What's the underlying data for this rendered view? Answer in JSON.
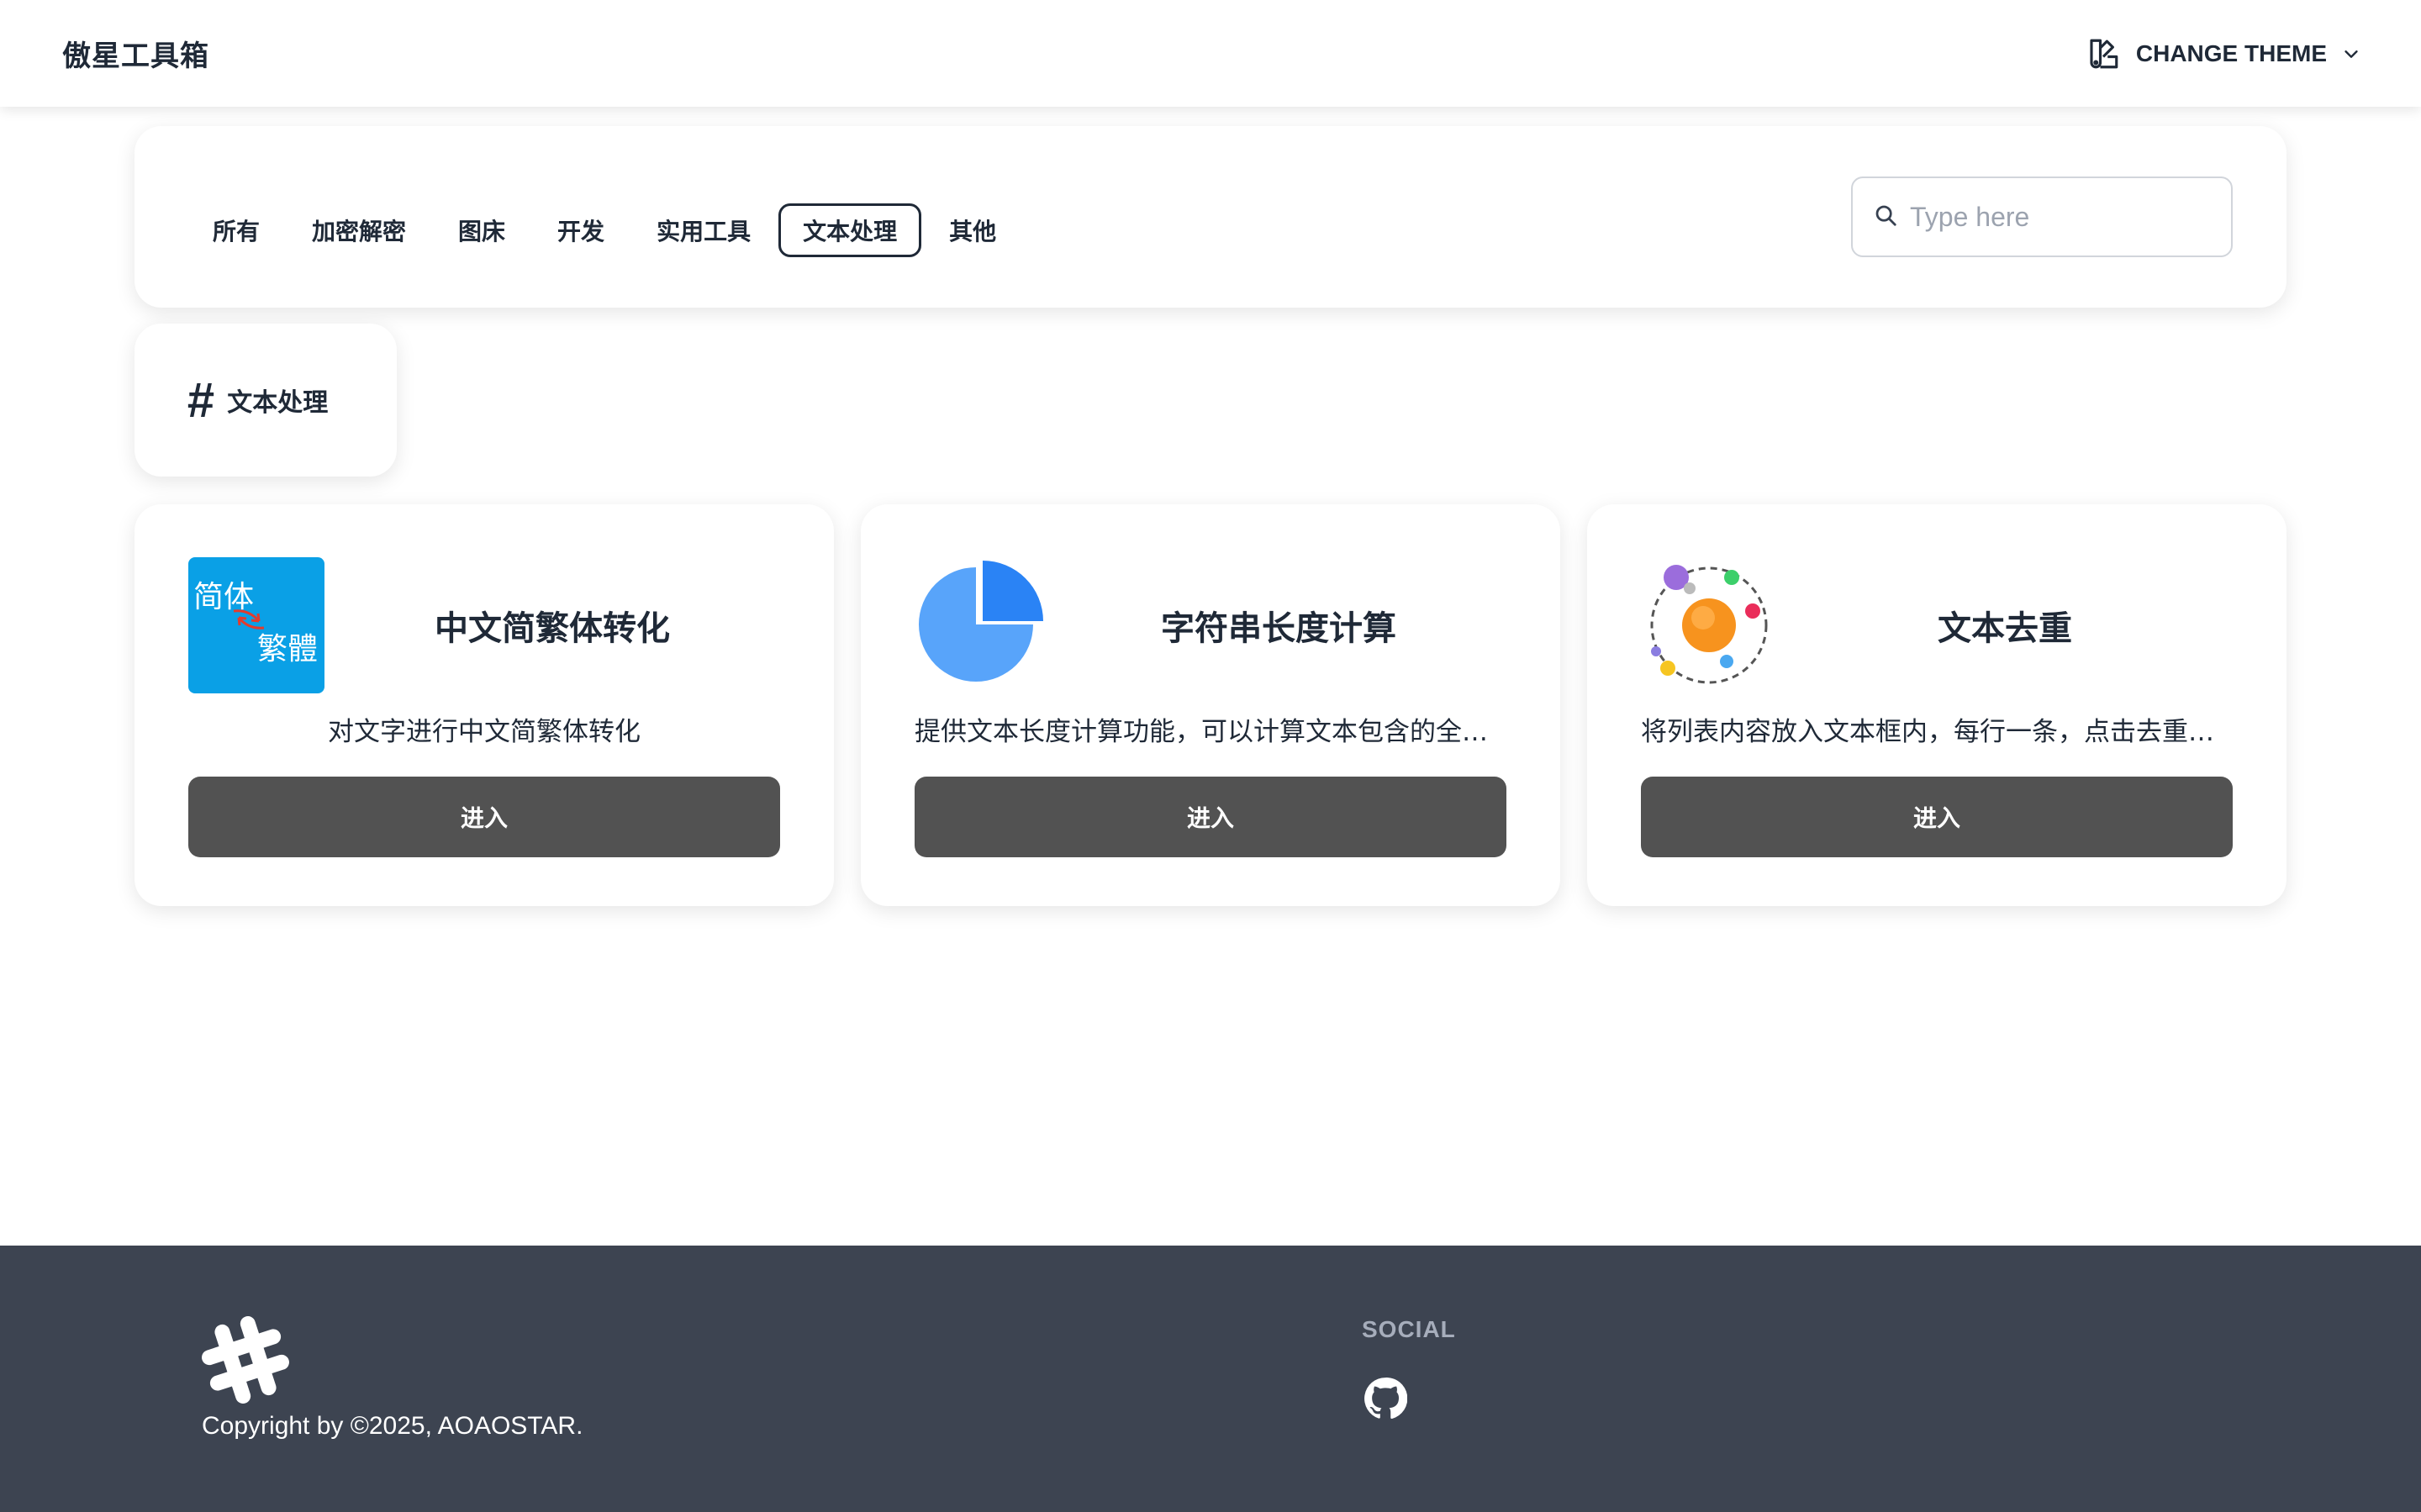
{
  "navbar": {
    "brand": "傲星工具箱",
    "theme_label": "CHANGE THEME",
    "theme_icon": "swatch-icon",
    "chevron_icon": "chevron-down-icon"
  },
  "filters": {
    "tabs": [
      {
        "label": "所有"
      },
      {
        "label": "加密解密"
      },
      {
        "label": "图床"
      },
      {
        "label": "开发"
      },
      {
        "label": "实用工具"
      },
      {
        "label": "文本处理",
        "active": true
      },
      {
        "label": "其他"
      }
    ],
    "search": {
      "placeholder": "Type here",
      "value": ""
    }
  },
  "category": {
    "icon": "hash-icon",
    "hash": "#",
    "title": "文本处理"
  },
  "cards": [
    {
      "title": "中文简繁体转化",
      "description": "对文字进行中文简繁体转化",
      "button": "进入",
      "icon": "simplified-traditional-icon",
      "icon_text_1": "简体",
      "icon_text_2": "繁體"
    },
    {
      "title": "字符串长度计算",
      "description": "提供文本长度计算功能，可以计算文本包含的全角字符、半角字符、中文字符、英文字符等",
      "button": "进入",
      "icon": "pie-chart-icon"
    },
    {
      "title": "文本去重",
      "description": "将列表内容放入文本框内，每行一条，点击去重按钮即可完成去重",
      "button": "进入",
      "icon": "orbit-icon"
    }
  ],
  "footer": {
    "logo_icon": "hashtag-logo-icon",
    "copyright": "Copyright by ©2025, AOAOSTAR.",
    "social_title": "SOCIAL",
    "social_icon": "github-icon"
  },
  "colors": {
    "footer_bg": "#3d4451",
    "button_bg": "#525252",
    "simp_icon_bg": "#0aa0e6",
    "pie_dark": "#2a83f5",
    "pie_light": "#58a4fa",
    "planet": "#f7931e"
  }
}
